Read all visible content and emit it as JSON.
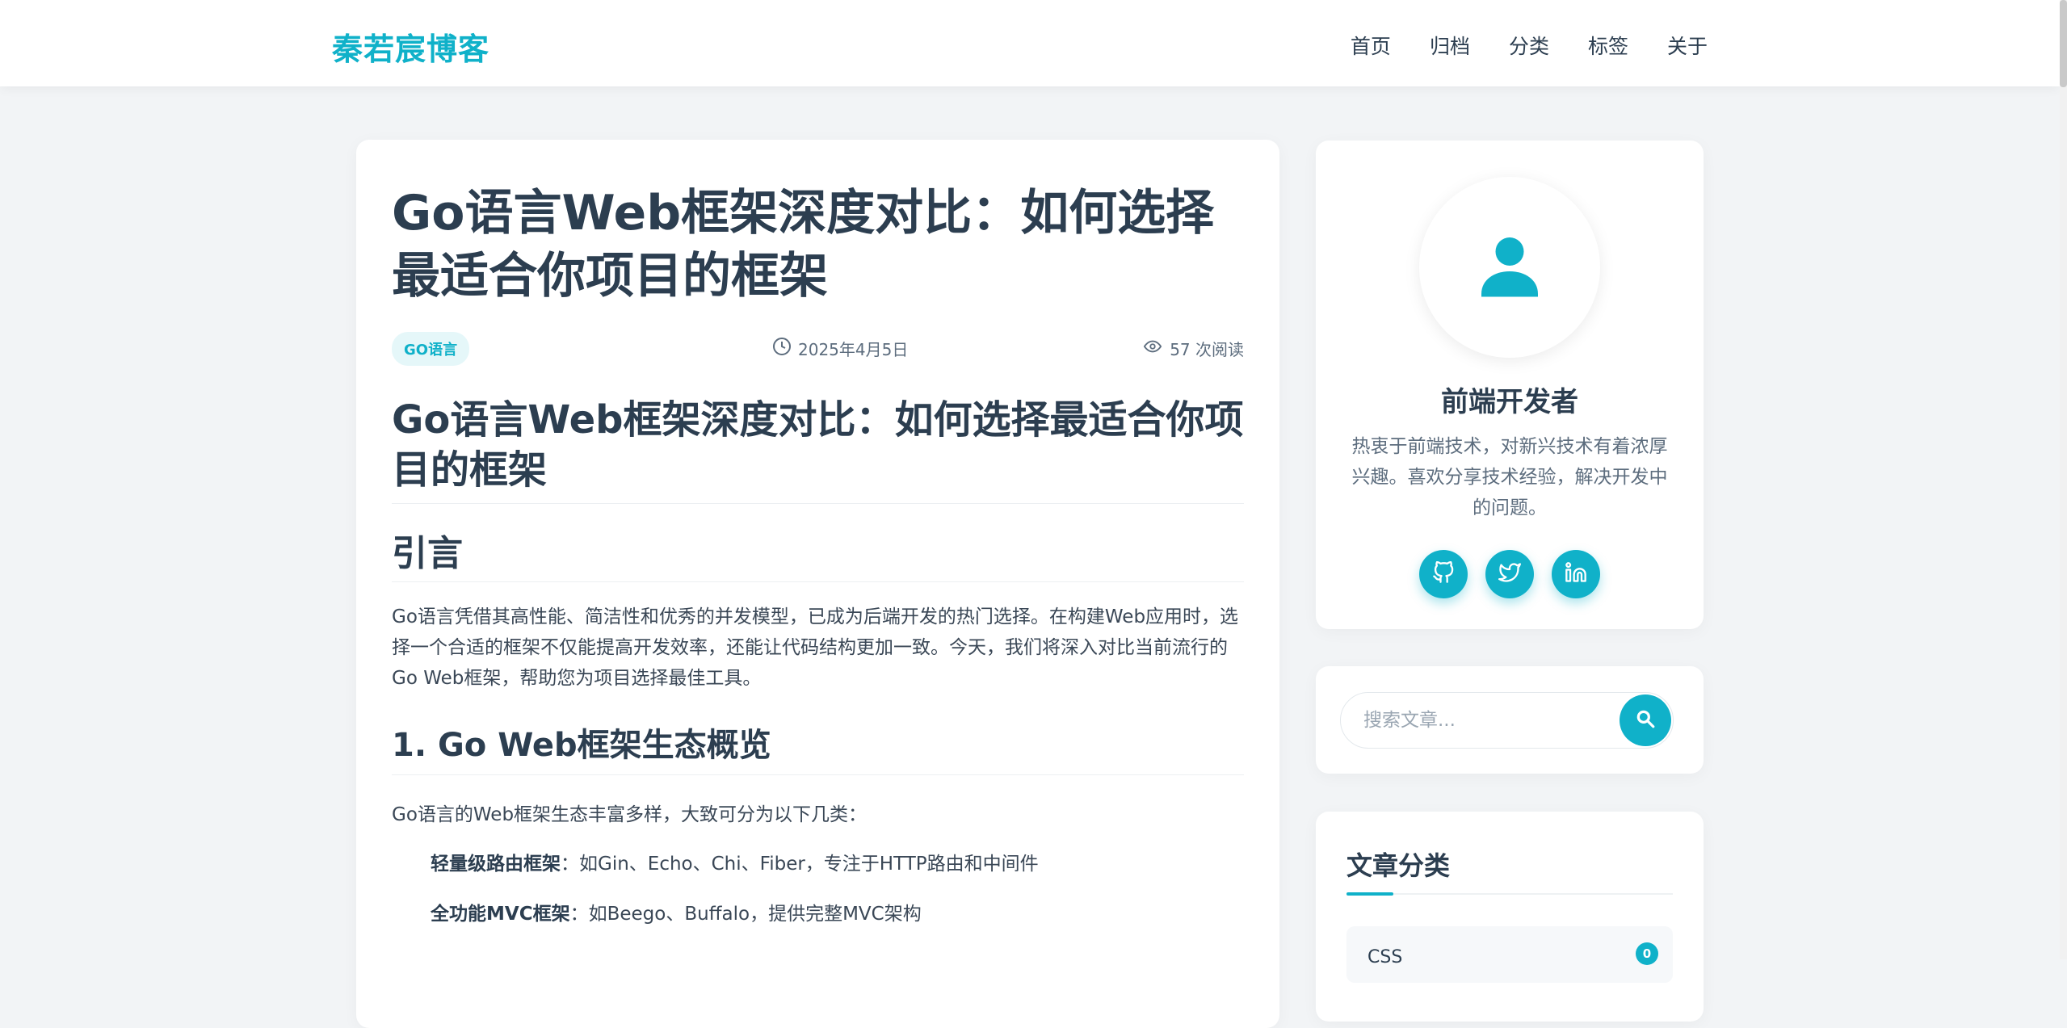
{
  "header": {
    "brand": "秦若宸博客",
    "nav": [
      "首页",
      "归档",
      "分类",
      "标签",
      "关于"
    ]
  },
  "article": {
    "title": "Go语言Web框架深度对比：如何选择最适合你项目的框架",
    "tag": "GO语言",
    "date": "2025年4月5日",
    "views": "57 次阅读",
    "h1": "Go语言Web框架深度对比：如何选择最适合你项目的框架",
    "intro_heading": "引言",
    "intro_text": "Go语言凭借其高性能、简洁性和优秀的并发模型，已成为后端开发的热门选择。在构建Web应用时，选择一个合适的框架不仅能提高开发效率，还能让代码结构更加一致。今天，我们将深入对比当前流行的Go Web框架，帮助您为项目选择最佳工具。",
    "section1_heading": "1. Go Web框架生态概览",
    "section1_text": "Go语言的Web框架生态丰富多样，大致可分为以下几类：",
    "list": [
      {
        "term": "轻量级路由框架",
        "desc": "：如Gin、Echo、Chi、Fiber，专注于HTTP路由和中间件"
      },
      {
        "term": "全功能MVC框架",
        "desc": "：如Beego、Buffalo，提供完整MVC架构"
      }
    ]
  },
  "profile": {
    "name": "前端开发者",
    "bio": "热衷于前端技术，对新兴技术有着浓厚兴趣。喜欢分享技术经验，解决开发中的问题。",
    "socials": [
      "github-icon",
      "twitter-icon",
      "linkedin-icon"
    ]
  },
  "search": {
    "placeholder": "搜索文章..."
  },
  "categories": {
    "title": "文章分类",
    "items": [
      {
        "name": "CSS",
        "count": "0"
      }
    ]
  },
  "colors": {
    "accent": "#10b1c9",
    "text": "#2c3e50",
    "background": "#f2f4f6"
  }
}
